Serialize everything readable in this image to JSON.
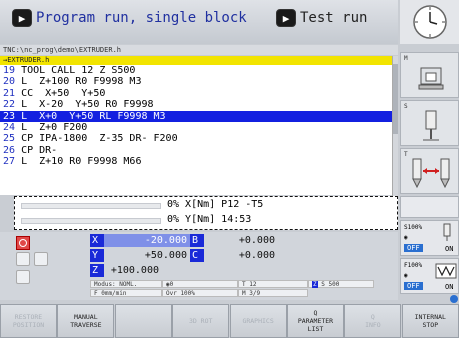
{
  "header": {
    "machine_mode_icon": "program-run-icon",
    "machine_mode": "Program run, single block",
    "programming_mode_icon": "test-run-icon",
    "programming_mode": "Test run"
  },
  "program": {
    "path": "TNC:\\nc_prog\\demo\\EXTRUDER.h",
    "file": "→EXTRUDER.h",
    "lines": [
      {
        "n": "19",
        "text": " TOOL CALL 12 Z S500",
        "active": false
      },
      {
        "n": "20",
        "text": " L  Z+100 R0 F9998 M3",
        "active": false
      },
      {
        "n": "21",
        "text": " CC  X+50  Y+50",
        "active": false
      },
      {
        "n": "22",
        "text": " L  X-20  Y+50 R0 F9998",
        "active": false
      },
      {
        "n": "23",
        "text": " L  X+0  Y+50 RL F9998 M3",
        "active": true
      },
      {
        "n": "24",
        "text": " L  Z+0 F200",
        "active": false
      },
      {
        "n": "25",
        "text": " CP IPA-1800  Z-35 DR- F200",
        "active": false
      },
      {
        "n": "26",
        "text": " CP DR-",
        "active": false
      },
      {
        "n": "27",
        "text": " L  Z+10 R0 F9998 M66",
        "active": false
      }
    ]
  },
  "status": {
    "line1": "0% X[Nm] P12 -T5",
    "line2": "0% Y[Nm] 14:53",
    "progress1": 0,
    "progress2": 0
  },
  "positions": {
    "x_label": "X",
    "x_value": "-20.000",
    "y_label": "Y",
    "y_value": "+50.000",
    "z_label": "Z",
    "z_value": "+100.000",
    "b_label": "B",
    "b_value": "+0.000",
    "c_label": "C",
    "c_value": "+0.000"
  },
  "info_row": {
    "modus": "Modus: NOML.",
    "feed_icon": "feed-icon",
    "feed_value": "0",
    "tool": "T 12",
    "spindle_axis": "Z",
    "spindle_speed": "S 500",
    "feed_unit": "F 0mm/min",
    "override": "Ovr 100%",
    "m_functions": "M 3/9"
  },
  "right_panel": {
    "m_label": "M",
    "s_label": "S",
    "t_label": "T",
    "s_override": "S100%",
    "s_state": "OFF",
    "s_on": "ON",
    "f_override": "F100%",
    "f_state": "OFF",
    "f_on": "ON"
  },
  "softkeys": [
    {
      "label": "RESTORE\nPOSITION",
      "enabled": false
    },
    {
      "label": "MANUAL\nTRAVERSE",
      "enabled": true
    },
    {
      "label": "",
      "enabled": false
    },
    {
      "label": "3D ROT",
      "enabled": false
    },
    {
      "label": "GRAPHICS",
      "enabled": false
    },
    {
      "label": "Q\nPARAMETER\nLIST",
      "enabled": true
    },
    {
      "label": "Q\nINFO",
      "enabled": false
    },
    {
      "label": "INTERNAL\nSTOP",
      "enabled": true
    }
  ],
  "colors": {
    "active_line": "#1320e0",
    "file_bar": "#f2e400",
    "axis_label": "#1a2ad8",
    "red_button": "#e04848"
  }
}
